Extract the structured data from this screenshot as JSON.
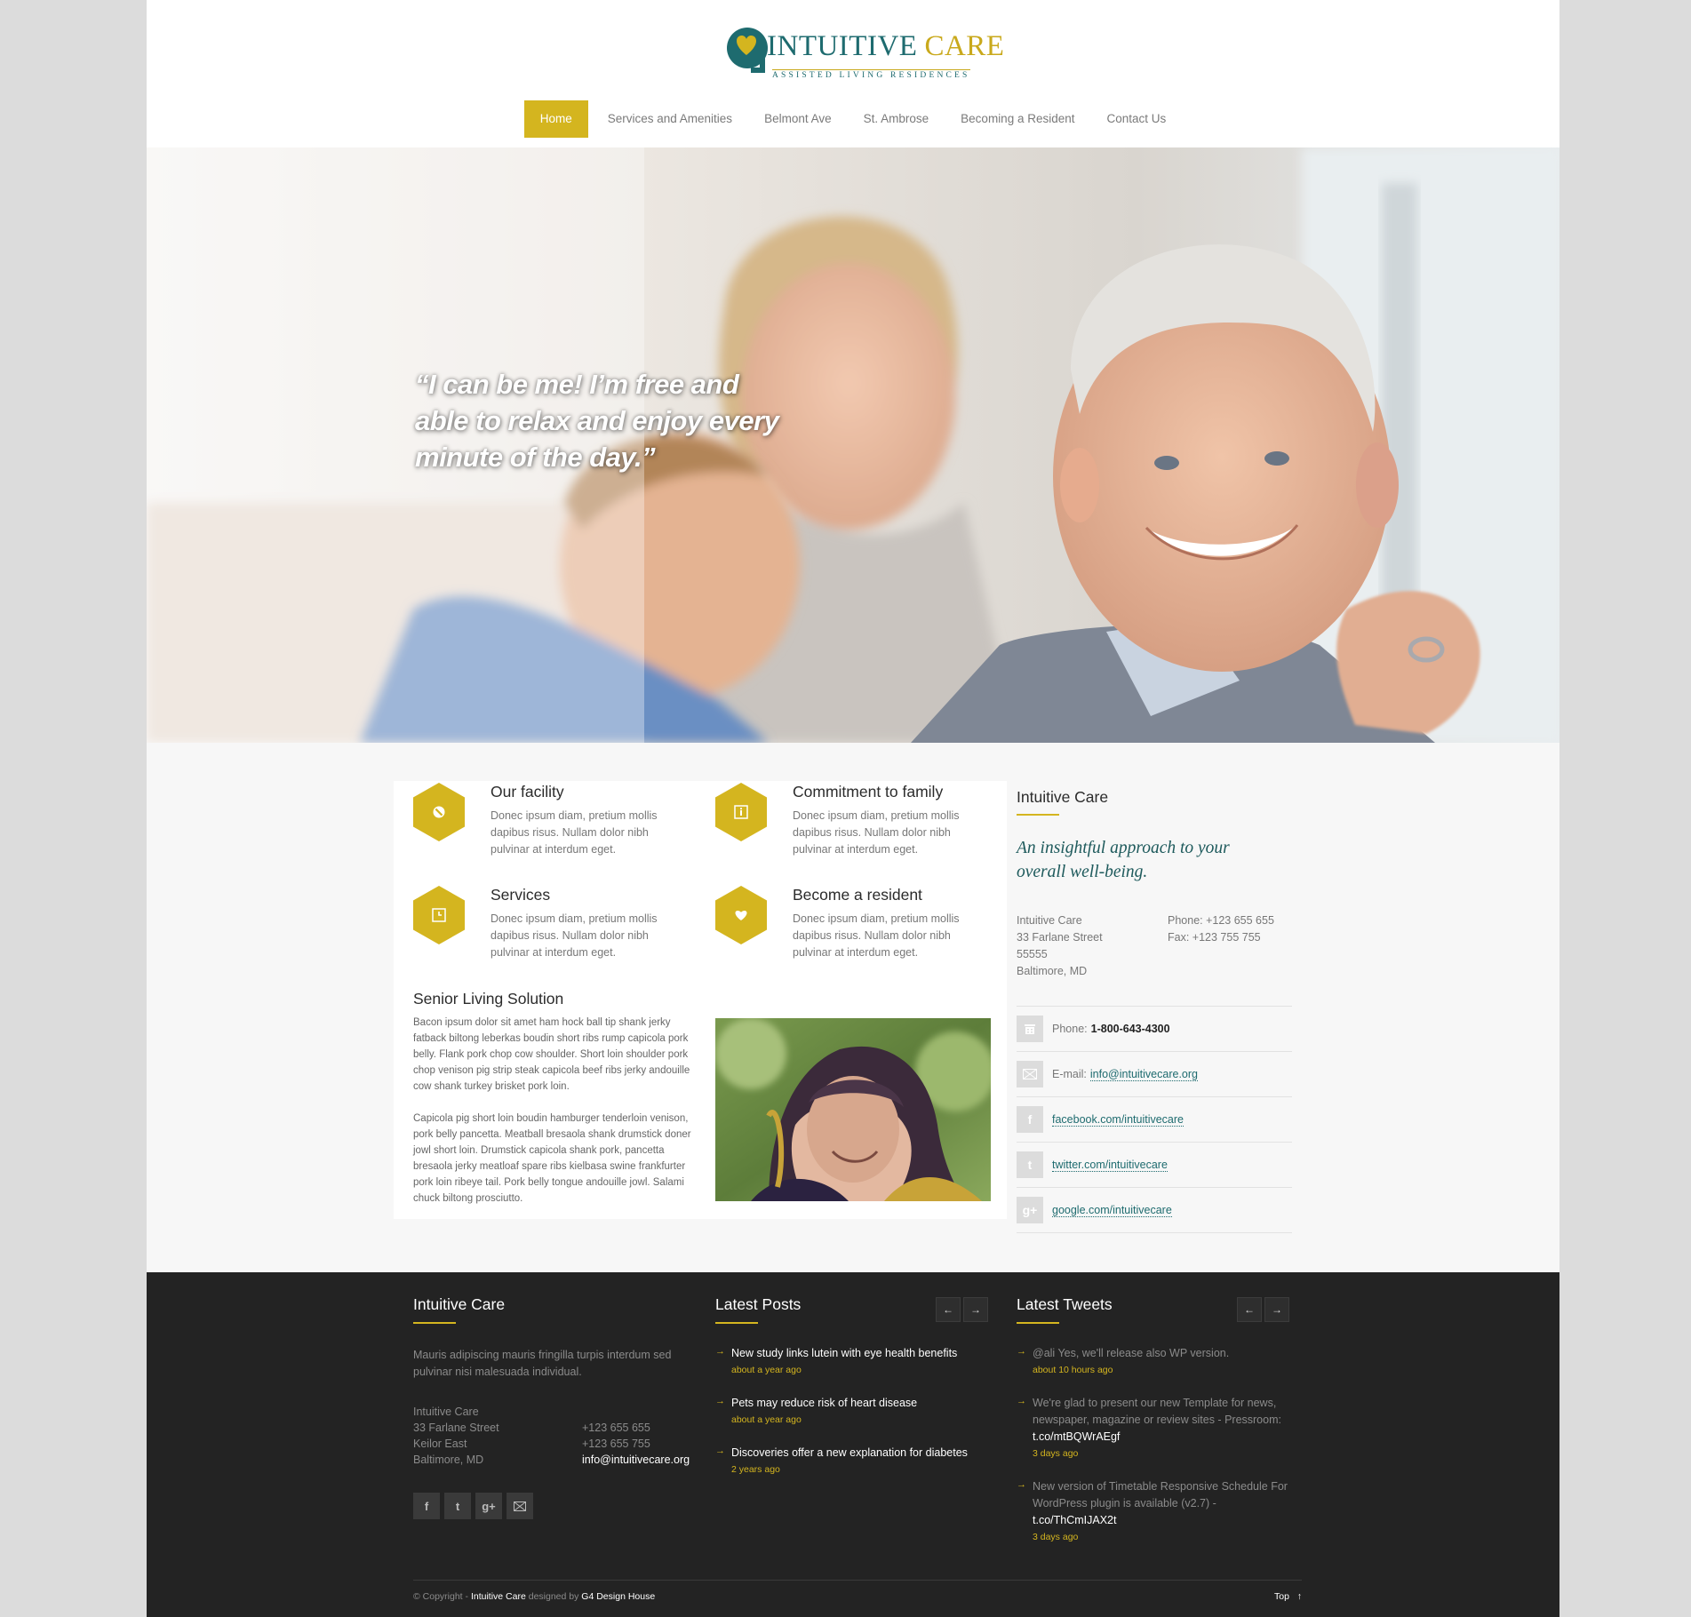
{
  "brand": {
    "name_part1": "INTUITIVE",
    "name_part2": "CARE",
    "tagline": "ASSISTED LIVING RESIDENCES"
  },
  "nav": [
    {
      "label": "Home",
      "active": true
    },
    {
      "label": "Services and Amenities"
    },
    {
      "label": "Belmont Ave"
    },
    {
      "label": "St. Ambrose"
    },
    {
      "label": "Becoming a Resident"
    },
    {
      "label": "Contact Us"
    }
  ],
  "hero": {
    "quote": "“I can be me! I’m free and able to relax and enjoy every minute of the day.”"
  },
  "features": [
    {
      "title": "Our facility",
      "text": "Donec ipsum diam, pretium mollis dapibus risus. Nullam dolor nibh pulvinar at interdum eget.",
      "icon": "ban-icon"
    },
    {
      "title": "Commitment to family",
      "text": "Donec ipsum diam, pretium mollis dapibus risus. Nullam dolor nibh pulvinar at interdum eget.",
      "icon": "info-icon"
    },
    {
      "title": "Services",
      "text": "Donec ipsum diam, pretium mollis dapibus risus. Nullam dolor nibh pulvinar at interdum eget.",
      "icon": "clock-icon"
    },
    {
      "title": "Become a resident",
      "text": "Donec ipsum diam, pretium mollis dapibus risus. Nullam dolor nibh pulvinar at interdum eget.",
      "icon": "heart-icon"
    }
  ],
  "senior": {
    "title": "Senior Living Solution",
    "para1": "Bacon ipsum dolor sit amet ham hock ball tip shank jerky fatback biltong leberkas boudin short ribs rump capicola pork belly. Flank pork chop cow shoulder. Short loin shoulder pork chop venison pig strip steak capicola beef ribs jerky andouille cow shank turkey brisket pork loin.",
    "para2": "Capicola pig short loin boudin hamburger tenderloin venison, pork belly pancetta. Meatball bresaola shank drumstick doner jowl short loin. Drumstick capicola shank pork, pancetta bresaola jerky meatloaf spare ribs kielbasa  swine frankfurter pork loin ribeye tail. Pork belly tongue andouille jowl. Salami chuck biltong prosciutto."
  },
  "sidebar": {
    "heading": "Intuitive Care",
    "tagline": "An insightful approach to your overall well-being.",
    "address": [
      "Intuitive Care",
      "33 Farlane Street",
      "55555",
      "Baltimore, MD"
    ],
    "phone_line": "Phone: +123 655 655",
    "fax_line": "Fax: +123 755 755",
    "contacts": {
      "phone_label": "Phone:",
      "phone_value": "1-800-643-4300",
      "email_label": "E-mail:",
      "email_value": "info@intuitivecare.org",
      "facebook": "facebook.com/intuitivecare",
      "twitter": "twitter.com/intuitivecare",
      "google": "google.com/intuitivecare"
    }
  },
  "footer": {
    "about": {
      "heading": "Intuitive Care",
      "text": "Mauris adipiscing mauris fringilla turpis interdum sed pulvinar nisi malesuada individual.",
      "address": [
        "Intuitive Care",
        "33 Farlane Street",
        "Keilor East",
        "Baltimore, MD"
      ],
      "phone": "+123 655 655",
      "fax": "+123 655 755",
      "email": "info@intuitivecare.org"
    },
    "posts": {
      "heading": "Latest Posts",
      "items": [
        {
          "title": "New study links lutein with eye health benefits",
          "time": "about a year ago"
        },
        {
          "title": "Pets may reduce risk of heart disease",
          "time": "about a year ago"
        },
        {
          "title": "Discoveries offer a new explanation for diabetes",
          "time": "2 years ago"
        }
      ]
    },
    "tweets": {
      "heading": "Latest Tweets",
      "items": [
        {
          "text": "@ali Yes, we'll release also WP version.",
          "link": "",
          "time": "about 10 hours ago"
        },
        {
          "text": "We're glad to present our new Template for news, newspaper, magazine or review sites - Pressroom:",
          "link": "t.co/mtBQWrAEgf",
          "time": "3 days ago"
        },
        {
          "text": "New version of Timetable Responsive Schedule For WordPress plugin is available (v2.7) -",
          "link": "t.co/ThCmIJAX2t",
          "time": "3 days ago"
        }
      ]
    },
    "copyright": {
      "prefix": "© Copyright -",
      "brand": "Intuitive Care",
      "designed_by": "designed by",
      "designer": "G4 Design House"
    },
    "top_label": "Top"
  },
  "colors": {
    "accent": "#d4b51f",
    "brand_teal": "#1e6b6f",
    "footer_bg": "#232323"
  }
}
